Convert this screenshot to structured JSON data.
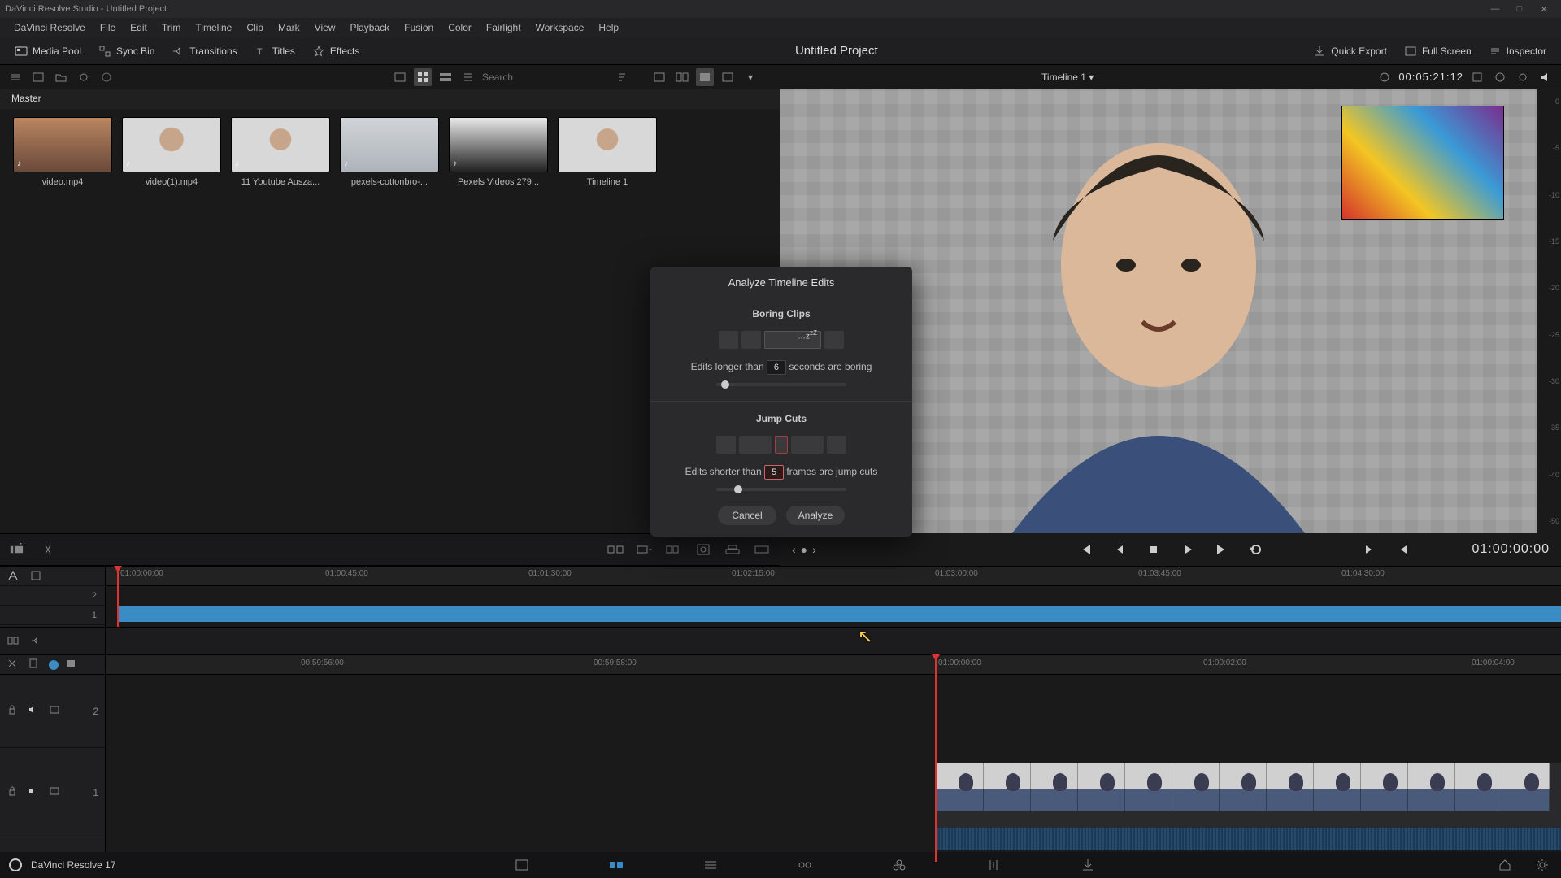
{
  "titlebar": {
    "text": "DaVinci Resolve Studio - Untitled Project"
  },
  "menu": [
    "DaVinci Resolve",
    "File",
    "Edit",
    "Trim",
    "Timeline",
    "Clip",
    "Mark",
    "View",
    "Playback",
    "Fusion",
    "Color",
    "Fairlight",
    "Workspace",
    "Help"
  ],
  "toolshelf": {
    "mediapool": "Media Pool",
    "syncbin": "Sync Bin",
    "transitions": "Transitions",
    "titles": "Titles",
    "effects": "Effects",
    "project": "Untitled Project",
    "quickexport": "Quick Export",
    "fullscreen": "Full Screen",
    "inspector": "Inspector"
  },
  "subtool": {
    "search_placeholder": "Search",
    "timeline_name": "Timeline 1",
    "timecode": "00:05:21:12"
  },
  "pool": {
    "header": "Master",
    "clips": [
      {
        "name": "video.mp4"
      },
      {
        "name": "video(1).mp4"
      },
      {
        "name": "11 Youtube Ausza..."
      },
      {
        "name": "pexels-cottonbro-..."
      },
      {
        "name": "Pexels Videos 279..."
      },
      {
        "name": "Timeline 1"
      }
    ]
  },
  "meter_marks": [
    "0",
    "-5",
    "-10",
    "-15",
    "-20",
    "-25",
    "-30",
    "-35",
    "-40",
    "-50"
  ],
  "playback": {
    "tc_right": "01:00:00:00"
  },
  "dialog": {
    "title": "Analyze Timeline Edits",
    "boring_title": "Boring Clips",
    "boring_pre": "Edits longer than",
    "boring_val": "6",
    "boring_post": "seconds are boring",
    "jump_title": "Jump Cuts",
    "jump_pre": "Edits shorter than",
    "jump_val": "5",
    "jump_post": "frames are jump cuts",
    "cancel": "Cancel",
    "analyze": "Analyze"
  },
  "mini_ruler": [
    "01:00:00:00",
    "01:00:45:00",
    "01:01:30:00",
    "01:02:15:00",
    "01:03:00:00",
    "01:03:45:00",
    "01:04:30:00"
  ],
  "mini_tracks": {
    "t2": "2",
    "t1": "1"
  },
  "big_ruler": [
    "00:59:56:00",
    "00:59:58:00",
    "01:00:00:00",
    "01:00:02:00",
    "01:00:04:00"
  ],
  "big_tracks": {
    "v2": "2",
    "v1": "1"
  },
  "app_label": "DaVinci Resolve 17"
}
